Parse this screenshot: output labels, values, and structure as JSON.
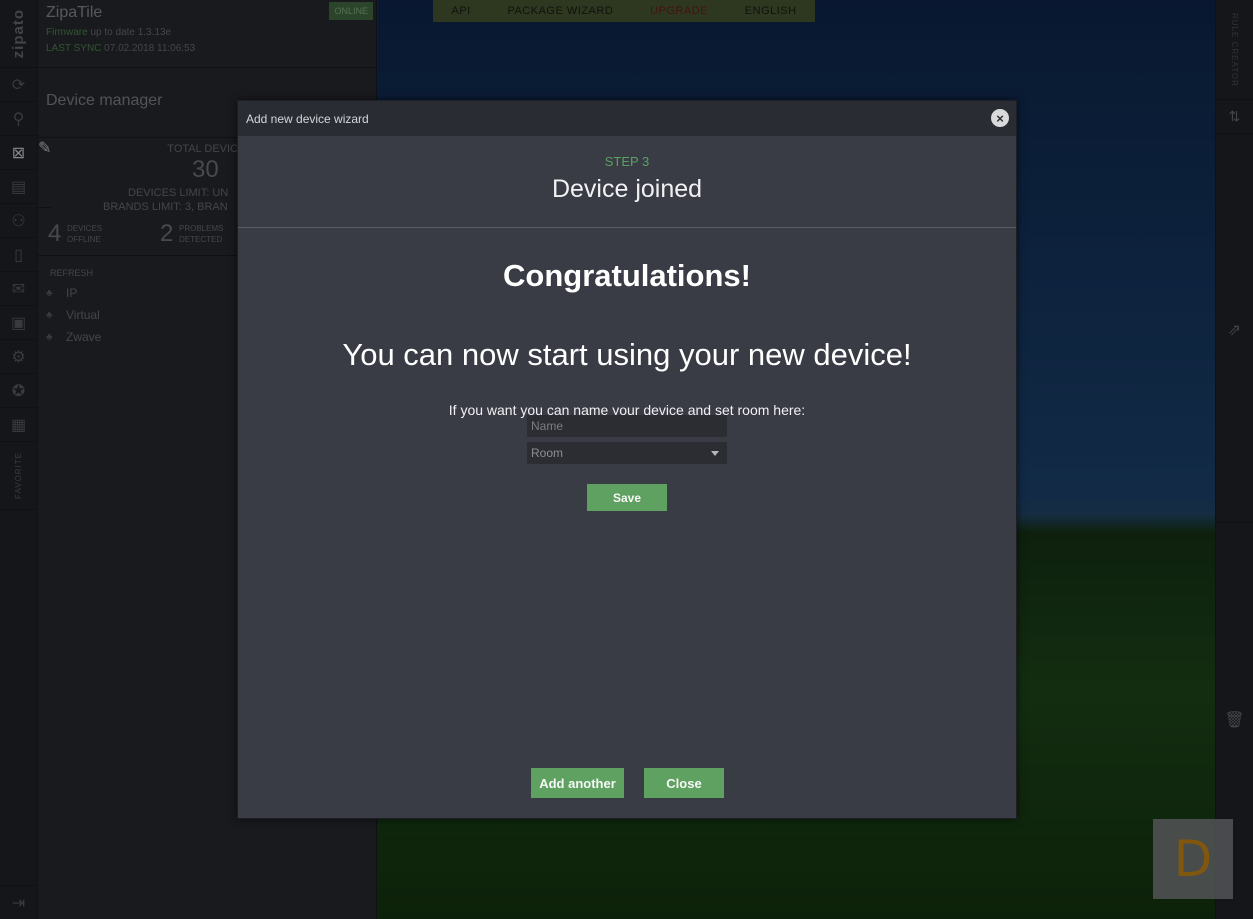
{
  "rail": {
    "brand": "zipato",
    "favorite": "FAVORITE"
  },
  "controller": {
    "name": "ZipaTile",
    "online": "ONLINE",
    "firmware_label": "Firmware",
    "firmware_text": "up to date 1.3.13e",
    "sync_label": "LAST SYNC",
    "sync_value": "07.02.2018 11:06:53"
  },
  "device_manager": {
    "title": "Device manager",
    "total_label": "TOTAL DEVIC",
    "total_value": "30",
    "devices_limit": "DEVICES LIMIT: UN",
    "brands_limit": "BRANDS LIMIT: 3, BRAN",
    "offline_value": "4",
    "offline_label_1": "DEVICES",
    "offline_label_2": "OFFLINE",
    "problems_value": "2",
    "problems_label_1": "PROBLEMS",
    "problems_label_2": "DETECTED",
    "refresh": "REFRESH",
    "networks": [
      "IP",
      "Virtual",
      "Zwave"
    ]
  },
  "topnav": {
    "items": [
      "API",
      "PACKAGE WIZARD",
      "UPGRADE",
      "ENGLISH"
    ]
  },
  "right_rail": {
    "rule_creator": "RULE CREATOR"
  },
  "badge": {
    "letter": "D"
  },
  "modal": {
    "title": "Add new device wizard",
    "step": "STEP 3",
    "step_title": "Device joined",
    "congrats": "Congratulations!",
    "subtitle": "You can now start using your new device!",
    "hint": "If you want you can name your device and set room here:",
    "name_placeholder": "Name",
    "room_value": "Room",
    "save_label": "Save",
    "add_another_label": "Add another",
    "close_label": "Close"
  },
  "colors": {
    "accent_green": "#5fa160",
    "upgrade_red": "#6e1d1d",
    "badge_orange": "#f29a1b"
  }
}
